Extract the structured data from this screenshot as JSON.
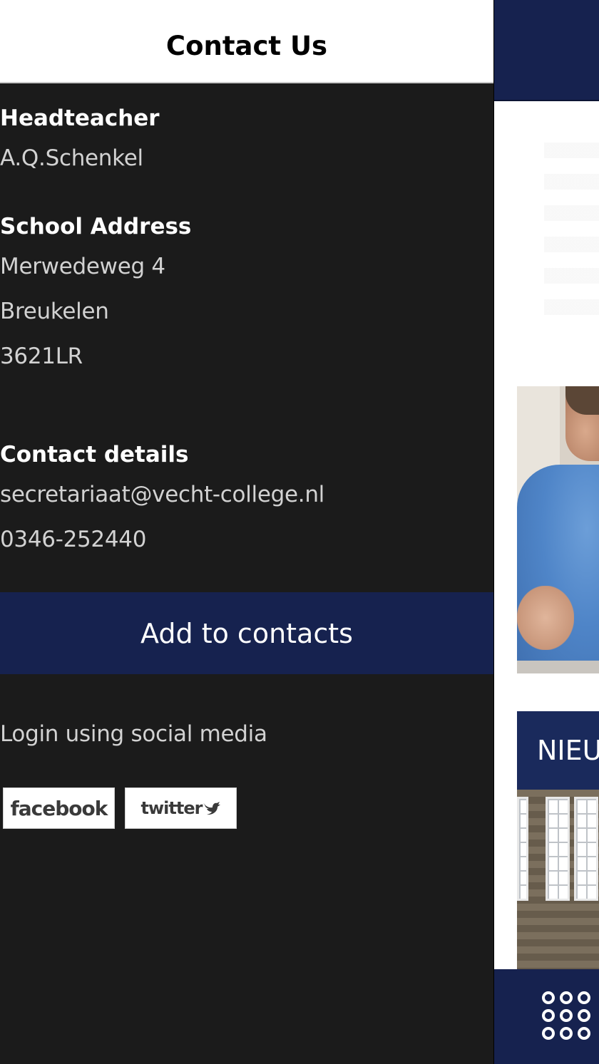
{
  "drawer": {
    "title": "Contact Us",
    "headteacher": {
      "label": "Headteacher",
      "name": "A.Q.Schenkel"
    },
    "address": {
      "label": "School Address",
      "lines": [
        "Merwedeweg 4",
        "Breukelen",
        "3621LR"
      ]
    },
    "contact": {
      "label": "Contact details",
      "email": "secretariaat@vecht-college.nl",
      "phone": "0346-252440"
    },
    "add_to_contacts_label": "Add to contacts",
    "social": {
      "prompt": "Login using social media",
      "facebook_label": "facebook",
      "twitter_label": "twitter"
    }
  },
  "app_background": {
    "news_banner_text": "NIEU",
    "menu_icon": "grid-icon"
  },
  "colors": {
    "drawer_bg": "#1b1b1b",
    "brand_navy": "#16224f",
    "header_bg": "#ffffff"
  }
}
